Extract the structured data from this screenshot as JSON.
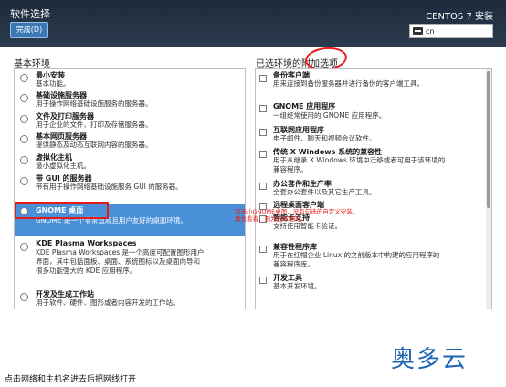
{
  "header": {
    "title": "软件选择",
    "done_label": "完成(D)",
    "product": "CENTOS 7 安装",
    "lang": "cn"
  },
  "base_env": {
    "title": "基本环境",
    "items": [
      {
        "name": "最小安装",
        "desc": [
          "基本功能。"
        ]
      },
      {
        "name": "基础设施服务器",
        "desc": [
          "用于操作网络基础设施服务的服务器。"
        ]
      },
      {
        "name": "文件及打印服务器",
        "desc": [
          "用于企业的文件、打印及存储服务器。"
        ]
      },
      {
        "name": "基本网页服务器",
        "desc": [
          "提供静态及动态互联网内容的服务器。"
        ]
      },
      {
        "name": "虚拟化主机",
        "desc": [
          "最小虚拟化主机。"
        ]
      },
      {
        "name": "带 GUI 的服务器",
        "desc": [
          "带有用于操作网络基础设施服务 GUI 的服务器。"
        ]
      },
      {
        "name": "GNOME 桌面",
        "desc": [
          "GNOME 是一个非常直观且用户友好的桌面环境。"
        ]
      },
      {
        "name": "KDE Plasma Workspaces",
        "desc": [
          "KDE Plasma Workspaces 是一个高度可配置图形用户",
          "界面，其中包括面板、桌面、系统图标以及桌面向导和",
          "很多功能强大的 KDE 应用程序。"
        ]
      },
      {
        "name": "开发及生成工作站",
        "desc": [
          "用于软件、硬件、图形或者内容开发的工作站。"
        ]
      }
    ]
  },
  "addons": {
    "title": "已选环境的附加选项",
    "items": [
      {
        "name": "备份客户端",
        "desc": [
          "用来连接到备份服务器并进行备份的客户端工具。"
        ]
      },
      {
        "name": "GNOME 应用程序",
        "desc": [
          "一组经常使用的 GNOME 应用程序。"
        ]
      },
      {
        "name": "互联网应用程序",
        "desc": [
          "电子邮件、聊天和视频会议软件。"
        ]
      },
      {
        "name": "传统 X Windows 系统的兼容性",
        "desc": [
          "用于从继承 X Windows 环境中迁移或者可用于该环境的",
          "兼容程序。"
        ]
      },
      {
        "name": "办公套件和生产率",
        "desc": [
          "全套办公套件以及其它生产工具。"
        ]
      },
      {
        "name": "远程桌面客户端",
        "desc": [
          ""
        ]
      },
      {
        "name": "智能卡支持",
        "desc": [
          "支持使用智能卡验证。"
        ]
      },
      {
        "name": "兼容性程序库",
        "desc": [
          "用于在红帽企业 Linux 的之前版本中构建的应用程序的",
          "兼容程序库。"
        ]
      },
      {
        "name": "开发工具",
        "desc": [
          "基本开发环境。"
        ]
      }
    ]
  },
  "annotation": [
    "勾选小GNOME桌面，没有勾选的自定义安装，",
    "再也看看，则为选环境的。"
  ],
  "bottom_text": "点击网络和主机名进去后把网线打开",
  "watermark": "奥多云",
  "colors": {
    "header": "#1e2a3a",
    "selected": "#4a90d9",
    "annotation": "#e31b1b",
    "watermark": "#1f64b5"
  }
}
